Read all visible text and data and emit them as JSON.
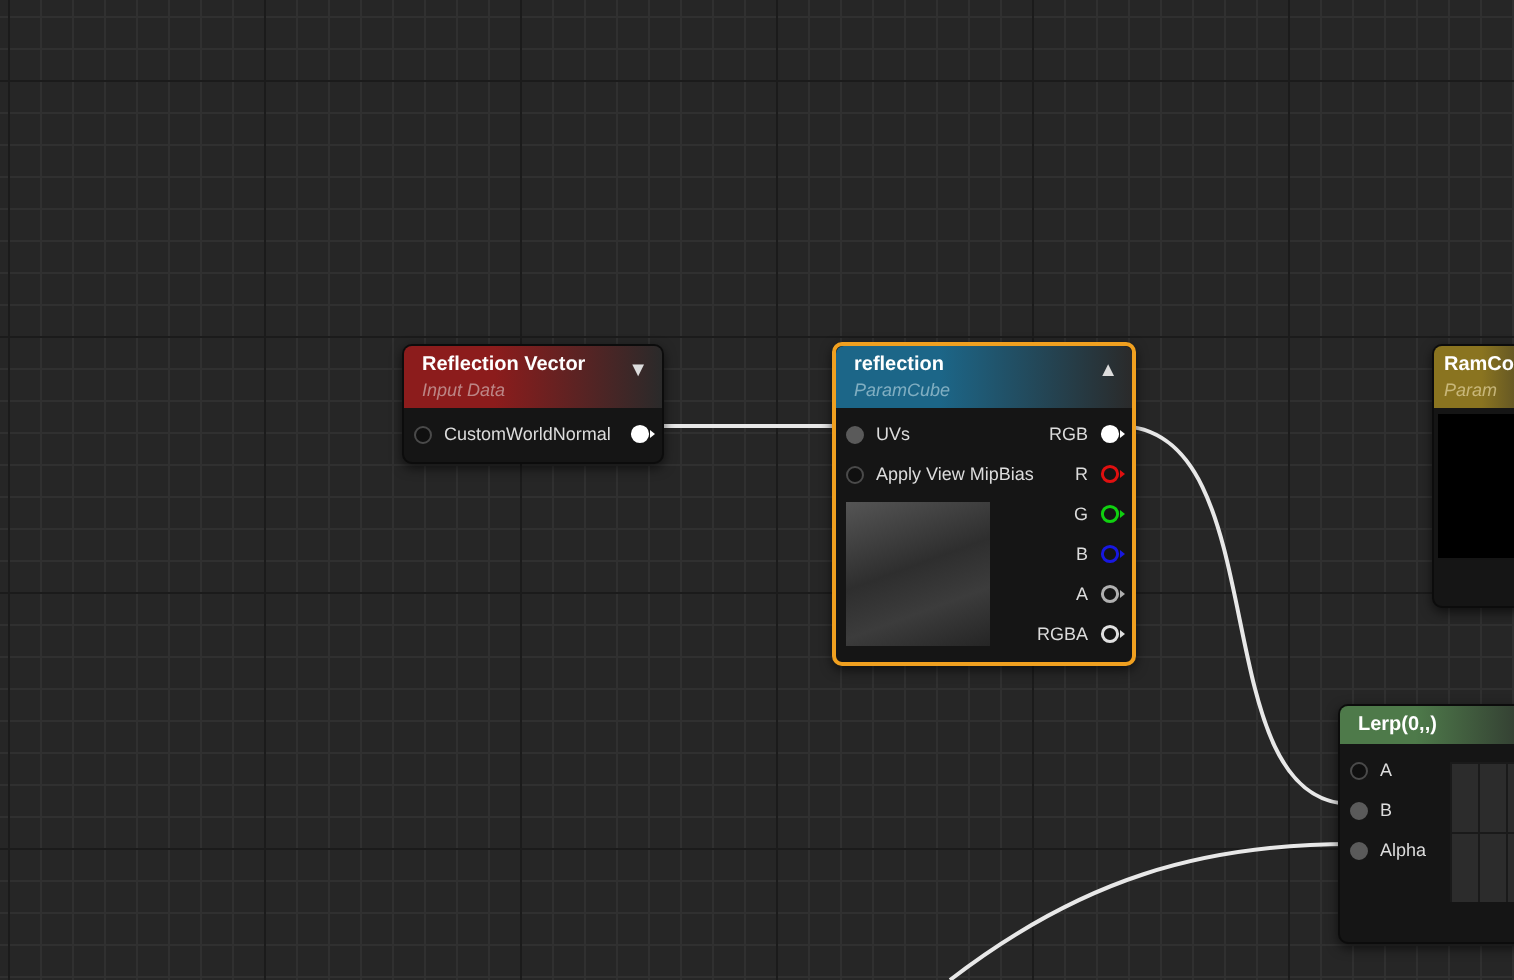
{
  "nodes": [
    {
      "kind": "expression",
      "title": "Reflection Vector",
      "subtitle": "Input Data",
      "color": "#8c1c1c",
      "selected": false,
      "toggle": "▼",
      "inputs": [
        {
          "label": "CustomWorldNormal",
          "connected": false
        }
      ],
      "outputs": [
        {
          "color": "#ffffff",
          "connected": true
        }
      ]
    },
    {
      "kind": "cube-param",
      "title": "reflection",
      "subtitle": "ParamCube",
      "color": "#1c6688",
      "selected": true,
      "toggle": "▲",
      "inputs": [
        {
          "label": "UVs",
          "connected": true
        },
        {
          "label": "Apply View MipBias",
          "connected": false
        }
      ],
      "outputs": [
        {
          "label": "RGB",
          "color": "#ffffff",
          "connected": true
        },
        {
          "label": "R",
          "color": "#e01010",
          "connected": false
        },
        {
          "label": "G",
          "color": "#10d010",
          "connected": false
        },
        {
          "label": "B",
          "color": "#1818e0",
          "connected": false
        },
        {
          "label": "A",
          "color": "#b0b0b0",
          "connected": false
        },
        {
          "label": "RGBA",
          "color": "#e0e0e0",
          "connected": false
        }
      ]
    },
    {
      "kind": "vector-param",
      "title": "RamCo",
      "subtitle": "Param",
      "color": "#8a7420",
      "selected": false
    },
    {
      "kind": "lerp",
      "title": "Lerp(0,,)",
      "color": "#4e7a4a",
      "selected": false,
      "inputs": [
        {
          "label": "A",
          "connected": false
        },
        {
          "label": "B",
          "connected": true
        },
        {
          "label": "Alpha",
          "connected": true
        }
      ]
    }
  ]
}
